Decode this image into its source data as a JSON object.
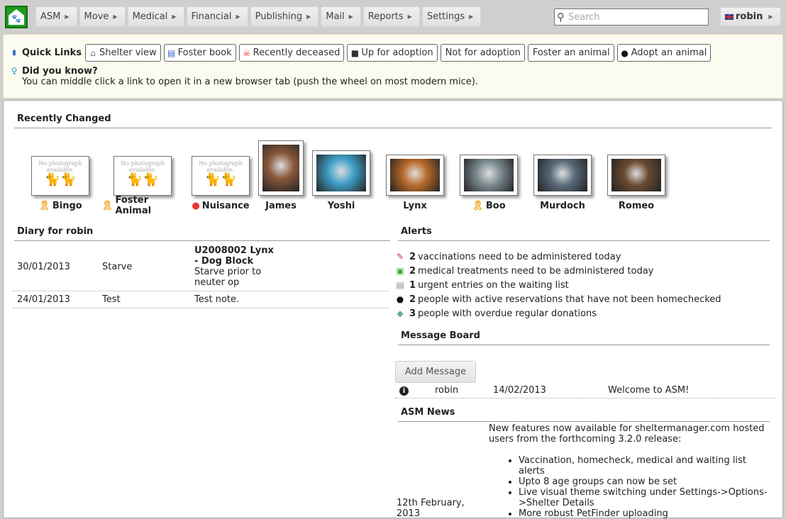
{
  "menu": [
    "ASM",
    "Move",
    "Medical",
    "Financial",
    "Publishing",
    "Mail",
    "Reports",
    "Settings"
  ],
  "search": {
    "placeholder": "Search"
  },
  "user": "robin",
  "quick_links": {
    "label": "Quick Links",
    "items": [
      {
        "label": "Shelter view",
        "icon": "house-icon"
      },
      {
        "label": "Foster book",
        "icon": "address-book-icon"
      },
      {
        "label": "Recently deceased",
        "icon": "skull-icon"
      },
      {
        "label": "Up for adoption",
        "icon": "cat-icon"
      },
      {
        "label": "Not for adoption",
        "icon": ""
      },
      {
        "label": "Foster an animal",
        "icon": ""
      },
      {
        "label": "Adopt an animal",
        "icon": "person-icon"
      }
    ]
  },
  "did_you_know": {
    "title": "Did you know?",
    "text": "You can middle click a link to open it in a new browser tab (push the wheel on most modern mice)."
  },
  "recently_changed": {
    "title": "Recently Changed",
    "no_photo": "No photograph available.",
    "animals": [
      {
        "name": "Bingo",
        "photo": false,
        "flag": "ribbon"
      },
      {
        "name": "Foster Animal",
        "photo": false,
        "flag": "ribbon"
      },
      {
        "name": "Nuisance",
        "photo": false,
        "flag": "skull"
      },
      {
        "name": "James",
        "photo": true,
        "color": "#8a5a3c"
      },
      {
        "name": "Yoshi",
        "photo": true,
        "color": "#3fa0c8"
      },
      {
        "name": "Lynx",
        "photo": true,
        "color": "#b86a2a"
      },
      {
        "name": "Boo",
        "photo": true,
        "flag": "ribbon",
        "color": "#7a8a90"
      },
      {
        "name": "Murdoch",
        "photo": true,
        "color": "#5a6a7a"
      },
      {
        "name": "Romeo",
        "photo": true,
        "color": "#6a4a30"
      }
    ]
  },
  "diary": {
    "title": "Diary for robin",
    "rows": [
      {
        "date": "30/01/2013",
        "by": "Starve",
        "subject": "U2008002 Lynx - Dog Block",
        "note": "Starve prior to neuter op"
      },
      {
        "date": "24/01/2013",
        "by": "Test",
        "subject": "",
        "note": "Test note."
      }
    ]
  },
  "alerts": {
    "title": "Alerts",
    "items": [
      {
        "count": "2",
        "text": "vaccinations need to be administered today",
        "icon": "syringe-icon"
      },
      {
        "count": "2",
        "text": "medical treatments need to be administered today",
        "icon": "medical-icon"
      },
      {
        "count": "1",
        "text": "urgent entries on the waiting list",
        "icon": "list-icon"
      },
      {
        "count": "2",
        "text": "people with active reservations that have not been homechecked",
        "icon": "person-icon"
      },
      {
        "count": "3",
        "text": "people with overdue regular donations",
        "icon": "money-icon"
      }
    ]
  },
  "message_board": {
    "title": "Message Board",
    "add_label": "Add Message",
    "messages": [
      {
        "user": "robin",
        "date": "14/02/2013",
        "text": "Welcome to ASM!"
      }
    ]
  },
  "news": {
    "title": "ASM News",
    "date": "12th February, 2013",
    "intro": "New features now available for sheltermanager.com hosted users from the forthcoming 3.2.0 release:",
    "items": [
      "Vaccination, homecheck, medical and waiting list alerts",
      "Upto 8 age groups can now be set",
      "Live visual theme switching under Settings->Options->Shelter Details",
      "More robust PetFinder uploading"
    ]
  }
}
